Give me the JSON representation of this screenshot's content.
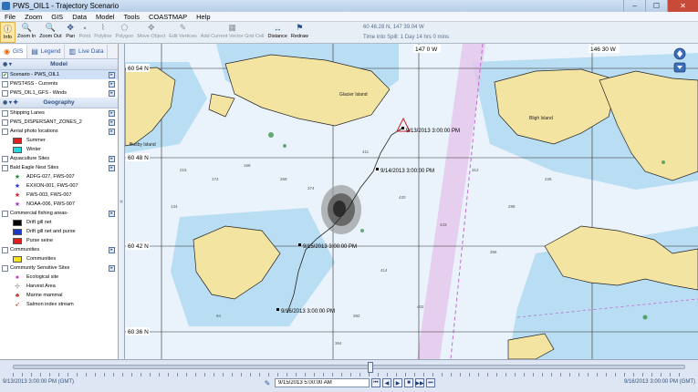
{
  "window": {
    "title": "PWS_OIL1 - Trajectory Scenario",
    "controls": [
      "–",
      "☐",
      "✕"
    ]
  },
  "menu": [
    "File",
    "Zoom",
    "GIS",
    "Data",
    "Model",
    "Tools",
    "COASTMAP",
    "Help"
  ],
  "toolbar": {
    "tools": [
      {
        "label": "Info",
        "icon": "ⓘ",
        "state": "active"
      },
      {
        "label": "Zoom In",
        "icon": "🔍",
        "state": "normal"
      },
      {
        "label": "Zoom Out",
        "icon": "🔍",
        "state": "normal"
      },
      {
        "label": "Pan",
        "icon": "✥",
        "state": "normal"
      },
      {
        "label": "Point",
        "icon": "•",
        "state": "disabled"
      },
      {
        "label": "Polyline",
        "icon": "⌇",
        "state": "disabled"
      },
      {
        "label": "Polygon",
        "icon": "⬠",
        "state": "disabled"
      },
      {
        "label": "Move Object",
        "icon": "✥",
        "state": "disabled"
      },
      {
        "label": "Edit Vertices",
        "icon": "✎",
        "state": "disabled"
      },
      {
        "label": "Add Current Vector Grid Cell",
        "icon": "▦",
        "state": "disabled"
      },
      {
        "label": "Distance",
        "icon": "↔",
        "state": "normal"
      },
      {
        "label": "Redraw",
        "icon": "⚑",
        "state": "normal"
      }
    ],
    "coordinates": "60 46.28 N, 147 39.04 W",
    "time_into_spill": "Time into Spill: 1 Day 14 hrs 0 mins"
  },
  "panel_tabs": [
    {
      "label": "GIS",
      "icon": "◉"
    },
    {
      "label": "Legend",
      "icon": "▤"
    },
    {
      "label": "Live Data",
      "icon": "▥"
    }
  ],
  "model_section": {
    "title": "Model",
    "controls": "◉ ▾",
    "layers": [
      {
        "name": "Scenario - PWS_OIL1",
        "checked": true,
        "selected": true
      },
      {
        "name": "PWST4SS - Currents",
        "checked": false
      },
      {
        "name": "PWS_OIL1_GFS - Winds",
        "checked": false
      }
    ]
  },
  "geography_section": {
    "title": "Geography",
    "controls": "◉ ▾ ✚",
    "items": [
      {
        "kind": "layer",
        "name": "Shipping Lanes"
      },
      {
        "kind": "layer",
        "name": "PWS_DISPERSANT_ZONES_2"
      },
      {
        "kind": "layer",
        "name": "Aerial photo locations"
      },
      {
        "kind": "legend",
        "name": "Summer",
        "color": "#e02020",
        "glyph": ""
      },
      {
        "kind": "legend",
        "name": "Winter",
        "color": "#22d8e0",
        "glyph": ""
      },
      {
        "kind": "layer",
        "name": "Aquaculture Sites"
      },
      {
        "kind": "layer",
        "name": "Bald Eagle Nest Sites"
      },
      {
        "kind": "legend",
        "name": "ADFG-027, FWS-007",
        "color": "#1f8a2a",
        "glyph": "★"
      },
      {
        "kind": "legend",
        "name": "EXXON-001, FWS-007",
        "color": "#2233cc",
        "glyph": "★"
      },
      {
        "kind": "legend",
        "name": "FWS-003, FWS-007",
        "color": "#dd1a1a",
        "glyph": "★"
      },
      {
        "kind": "legend",
        "name": "NOAA-006, FWS-007",
        "color": "#b02ad0",
        "glyph": "★"
      },
      {
        "kind": "layer",
        "name": "Commercial fishing areas-"
      },
      {
        "kind": "legend",
        "name": "Drift gill net",
        "color": "#000000",
        "glyph": ""
      },
      {
        "kind": "legend",
        "name": "Drift gill net and purse",
        "color": "#1b38c8",
        "glyph": ""
      },
      {
        "kind": "legend",
        "name": "Purse seine",
        "color": "#e41c1c",
        "glyph": ""
      },
      {
        "kind": "layer",
        "name": "Communities"
      },
      {
        "kind": "legend",
        "name": "Communities",
        "color": "#f4e21a",
        "glyph": ""
      },
      {
        "kind": "layer",
        "name": "Community Sensitive Sites"
      },
      {
        "kind": "legend",
        "name": "Ecological site",
        "color": "#e021e0",
        "glyph": "●"
      },
      {
        "kind": "legend",
        "name": "Harvest Area",
        "color": "#333333",
        "glyph": "⊹"
      },
      {
        "kind": "legend",
        "name": "Marine mammal",
        "color": "#b73a20",
        "glyph": "♣"
      },
      {
        "kind": "legend",
        "name": "Salmon index stream",
        "color": "#c23010",
        "glyph": "➶"
      }
    ]
  },
  "map": {
    "lat_labels": [
      "60 54 N",
      "60 48 N",
      "60 42 N",
      "60 36 N"
    ],
    "lon_labels": [
      "147 0 W",
      "146 30 W"
    ],
    "trajectory_labels": [
      "9/13/2013 3:00:00 PM",
      "9/14/2013 3:00:00 PM",
      "9/15/2013 3:00:00 PM",
      "9/16/2013 3:00:00 PM"
    ],
    "place_names": [
      "Glacier Island",
      "Bligh Island",
      "Busby Island"
    ]
  },
  "timebar": {
    "start": "9/13/2013 3:00:00 PM (GMT)",
    "end": "9/16/2013 3:00:00 PM (GMT)",
    "current": "9/15/2013 5:00:00 AM",
    "position": 0.53,
    "buttons": [
      "⏮",
      "◀",
      "▶",
      "■",
      "▶▶",
      "⏭"
    ]
  }
}
